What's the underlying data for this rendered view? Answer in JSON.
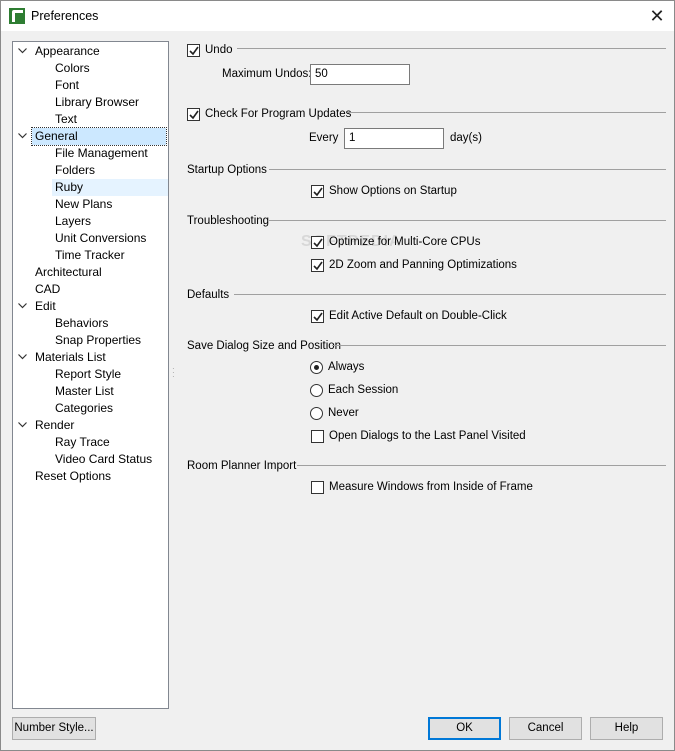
{
  "window": {
    "title": "Preferences",
    "close_glyph": "✕",
    "app_icon": "chief-architect-icon"
  },
  "tree": [
    {
      "label": "Appearance",
      "level": 0,
      "expanded": true
    },
    {
      "label": "Colors",
      "level": 1
    },
    {
      "label": "Font",
      "level": 1
    },
    {
      "label": "Library Browser",
      "level": 1
    },
    {
      "label": "Text",
      "level": 1
    },
    {
      "label": "General",
      "level": 0,
      "expanded": true,
      "selected": true
    },
    {
      "label": "File Management",
      "level": 1
    },
    {
      "label": "Folders",
      "level": 1
    },
    {
      "label": "Ruby",
      "level": 1,
      "hover": true
    },
    {
      "label": "New Plans",
      "level": 1
    },
    {
      "label": "Layers",
      "level": 1
    },
    {
      "label": "Unit Conversions",
      "level": 1
    },
    {
      "label": "Time Tracker",
      "level": 1
    },
    {
      "label": "Architectural",
      "level": 0
    },
    {
      "label": "CAD",
      "level": 0
    },
    {
      "label": "Edit",
      "level": 0,
      "expanded": true
    },
    {
      "label": "Behaviors",
      "level": 1
    },
    {
      "label": "Snap Properties",
      "level": 1
    },
    {
      "label": "Materials List",
      "level": 0,
      "expanded": true
    },
    {
      "label": "Report Style",
      "level": 1
    },
    {
      "label": "Master List",
      "level": 1
    },
    {
      "label": "Categories",
      "level": 1
    },
    {
      "label": "Render",
      "level": 0,
      "expanded": true
    },
    {
      "label": "Ray Trace",
      "level": 1
    },
    {
      "label": "Video Card Status",
      "level": 1
    },
    {
      "label": "Reset Options",
      "level": 0
    }
  ],
  "undo": {
    "label": "Undo",
    "checked": true,
    "max_label": "Maximum Undos:",
    "max_value": "50"
  },
  "updates": {
    "label": "Check For Program Updates",
    "checked": true,
    "every_label": "Every",
    "every_value": "1",
    "unit": "day(s)"
  },
  "startup": {
    "heading": "Startup Options",
    "show_options": {
      "label": "Show Options on Startup",
      "checked": true
    }
  },
  "troubleshooting": {
    "heading": "Troubleshooting",
    "multicore": {
      "label": "Optimize for Multi-Core CPUs",
      "checked": true
    },
    "zoom": {
      "label": "2D Zoom and Panning Optimizations",
      "checked": true
    }
  },
  "defaults": {
    "heading": "Defaults",
    "edit_active": {
      "label": "Edit Active Default on Double-Click",
      "checked": true
    }
  },
  "save_dialog": {
    "heading": "Save Dialog Size and Position",
    "always": {
      "label": "Always",
      "selected": true
    },
    "each_session": {
      "label": "Each Session",
      "selected": false
    },
    "never": {
      "label": "Never",
      "selected": false
    },
    "open_last": {
      "label": "Open Dialogs to the Last Panel Visited",
      "checked": false
    }
  },
  "room_planner": {
    "heading": "Room Planner Import",
    "measure": {
      "label": "Measure Windows from Inside of Frame",
      "checked": false
    }
  },
  "buttons": {
    "number_style": "Number Style...",
    "ok": "OK",
    "cancel": "Cancel",
    "help": "Help"
  },
  "watermark": "SOFTPEDIA"
}
